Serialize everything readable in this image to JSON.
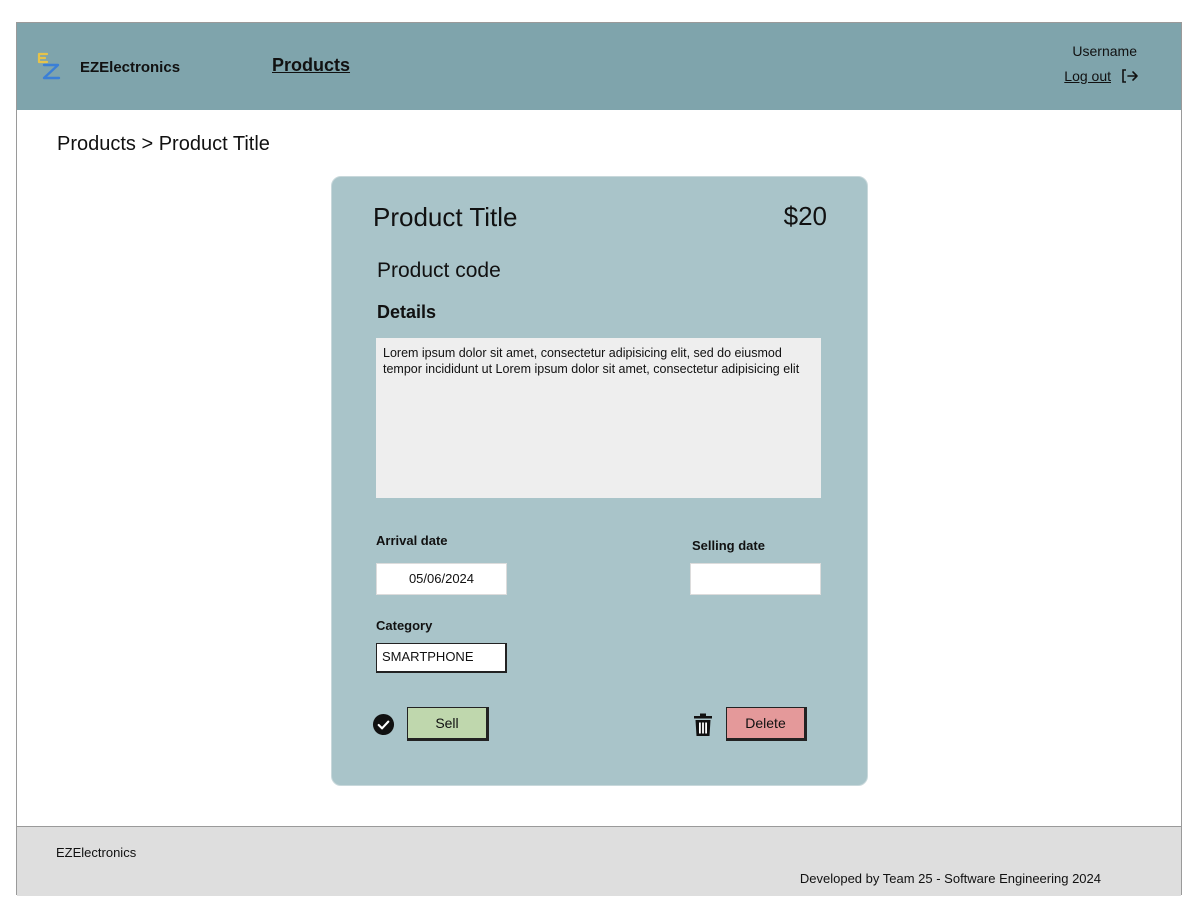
{
  "header": {
    "brand": "EZElectronics",
    "nav_products": "Products",
    "username": "Username",
    "logout": "Log out"
  },
  "breadcrumb": "Products > Product Title",
  "product": {
    "title": "Product Title",
    "price": "$20",
    "code": "Product code",
    "details_heading": "Details",
    "details_text": "Lorem ipsum dolor sit amet, consectetur adipisicing elit, sed do eiusmod tempor incididunt ut Lorem ipsum dolor sit amet, consectetur adipisicing elit",
    "arrival_label": "Arrival date",
    "arrival_value": "05/06/2024",
    "selling_label": "Selling date",
    "selling_value": "",
    "category_label": "Category",
    "category_value": "SMARTPHONE",
    "sell_label": "Sell",
    "delete_label": "Delete"
  },
  "footer": {
    "brand": "EZElectronics",
    "credit": "Developed by Team 25 - Software Engineering 2024"
  },
  "colors": {
    "header_bg": "#7fa4ac",
    "card_bg": "#a9c4c9",
    "sell_bg": "#bfd7ad",
    "delete_bg": "#e4999a",
    "footer_bg": "#dedede"
  },
  "icons": [
    "ez-logo-icon",
    "logout-icon",
    "check-circle-icon",
    "trash-icon"
  ]
}
